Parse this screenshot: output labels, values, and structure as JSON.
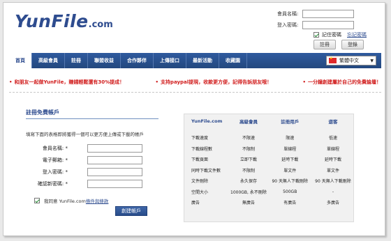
{
  "logo": {
    "main": "YunFile",
    "tld": ".com"
  },
  "login": {
    "member_label": "會員名稱:",
    "password_label": "登入密碼:",
    "remember_label": "記住密碼",
    "forgot_link": "忘記密碼",
    "register_button": "註冊",
    "login_button": "登錄"
  },
  "nav": {
    "items": [
      "首頁",
      "高級會員",
      "註冊",
      "聯盟收益",
      "合作夥伴",
      "上傳接口",
      "最新活動",
      "收藏園"
    ],
    "active_index": 0,
    "language": "繁體中文"
  },
  "promo": [
    "和朋友一起做YunFile，賺錢輕鬆還有30%提成！",
    "支持paypal提現，收款更方便，記得告訴朋友哦！",
    "一分鐘創建屬於自己的免費論壇！"
  ],
  "register": {
    "title": "註冊免費帳戶",
    "description": "填寫下面的表格即將獲得一個可以更方便上傳或下載的帳戶",
    "fields": [
      {
        "label": "會員名稱: *",
        "value": ""
      },
      {
        "label": "電子郵箱: *",
        "value": ""
      },
      {
        "label": "登入密碼: *",
        "value": ""
      },
      {
        "label": "確認新密碼: *",
        "value": ""
      }
    ],
    "agree_text": "我同意 YunFile.com",
    "terms_link": "條件與條款",
    "submit": "創建帳戶"
  },
  "compare": {
    "headers": [
      "YunFile.com",
      "高級會員",
      "註冊用戶",
      "遊客"
    ],
    "rows": [
      [
        "下載速度",
        "不限速",
        "限速",
        "低速"
      ],
      [
        "下載線程數",
        "不限制",
        "單線程",
        "單線程"
      ],
      [
        "下載頁面",
        "立即下載",
        "延時下載",
        "延時下載"
      ],
      [
        "同時下載文件數",
        "不限制",
        "單文件",
        "單文件"
      ],
      [
        "文件刪除",
        "永久保存",
        "90 天無人下載刪除",
        "90 天無人下載刪除"
      ],
      [
        "空間大小",
        "1000GB, 永不刪除",
        "500GB",
        "-"
      ],
      [
        "廣告",
        "無廣告",
        "有廣告",
        "多廣告"
      ]
    ]
  },
  "colors": {
    "brand_blue": "#2e4c8f",
    "promo_red": "#d11d1d"
  }
}
